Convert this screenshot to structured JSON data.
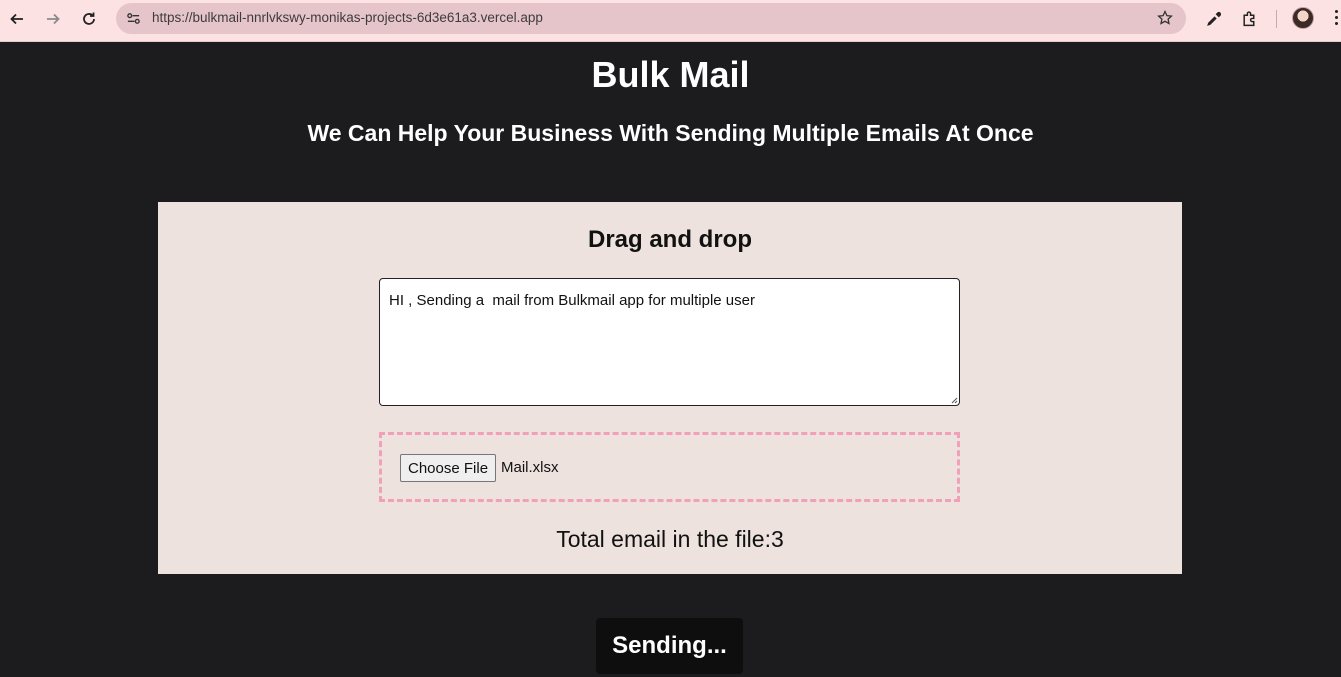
{
  "browser": {
    "url": "https://bulkmail-nnrlvkswy-monikas-projects-6d3e61a3.vercel.app",
    "icons": [
      "back-icon",
      "forward-icon",
      "reload-icon",
      "site-info-icon",
      "bookmark-star-icon",
      "eyedropper-icon",
      "extensions-icon",
      "profile-avatar",
      "menu-icon"
    ],
    "accent": "#fde2e4"
  },
  "header": {
    "title": "Bulk Mail",
    "subtitle": "We Can Help Your Business With Sending Multiple Emails At Once"
  },
  "panel": {
    "title": "Drag and drop",
    "message_value": "HI , Sending a  mail from Bulkmail app for multiple user",
    "file_button_label": "Choose File",
    "file_name": "Mail.xlsx",
    "count_label": "Total email in the file:",
    "count_value": "3",
    "background": "#ede2de",
    "drop_border_color": "#f0a0b8"
  },
  "send_button": {
    "label": "Sending..."
  }
}
